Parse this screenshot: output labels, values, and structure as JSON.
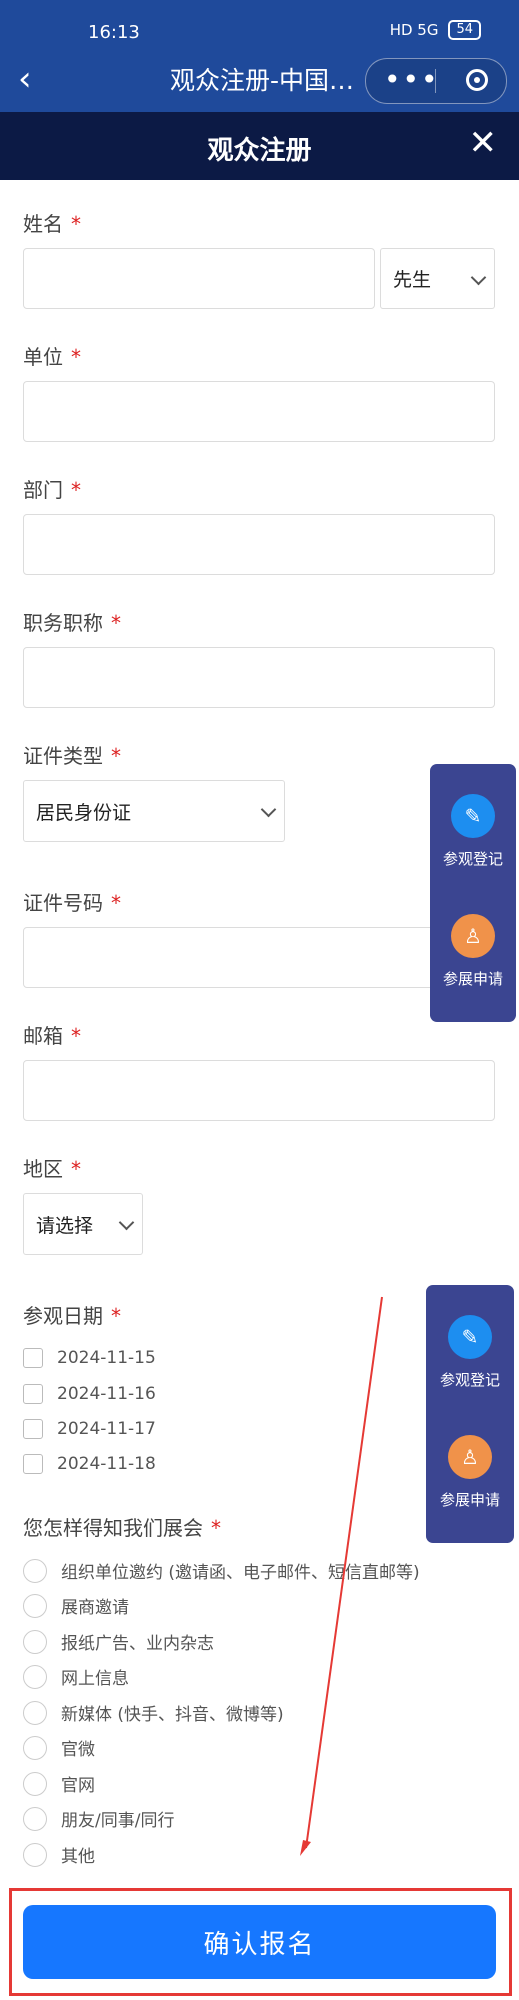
{
  "status_bar": {
    "time": "16:13",
    "icons_text": "HD 5G",
    "battery": "54"
  },
  "nav": {
    "back_glyph": "‹",
    "title": "观众注册-中国…",
    "menu_glyph": "•••"
  },
  "modal": {
    "title": "观众注册",
    "close_glyph": "✕"
  },
  "form": {
    "required_mark": "*",
    "name": {
      "label": "姓名",
      "value": "",
      "title_select": "先生"
    },
    "company": {
      "label": "单位",
      "value": ""
    },
    "department": {
      "label": "部门",
      "value": ""
    },
    "job_title": {
      "label": "职务职称",
      "value": ""
    },
    "id_type": {
      "label": "证件类型",
      "selected": "居民身份证"
    },
    "id_number": {
      "label": "证件号码",
      "value": ""
    },
    "email": {
      "label": "邮箱",
      "value": ""
    },
    "region": {
      "label": "地区",
      "selected": "请选择"
    },
    "visit_date": {
      "label": "参观日期",
      "options": [
        "2024-11-15",
        "2024-11-16",
        "2024-11-17",
        "2024-11-18"
      ]
    },
    "source": {
      "label": "您怎样得知我们展会",
      "options": [
        "组织单位邀约 (邀请函、电子邮件、短信直邮等)",
        "展商邀请",
        "报纸广告、业内杂志",
        "网上信息",
        "新媒体 (快手、抖音、微博等)",
        "官微",
        "官网",
        "朋友/同事/同行",
        "其他"
      ]
    }
  },
  "float_panel": {
    "visit_label": "参观登记",
    "exhibit_label": "参展申请"
  },
  "submit": {
    "label": "确认报名"
  },
  "colors": {
    "nav_bg": "#1f4a9b",
    "modal_header_bg": "#0c1a45",
    "required": "#dd2222",
    "primary": "#1677ff",
    "panel": "#3b4591",
    "annotation": "#e53935"
  }
}
